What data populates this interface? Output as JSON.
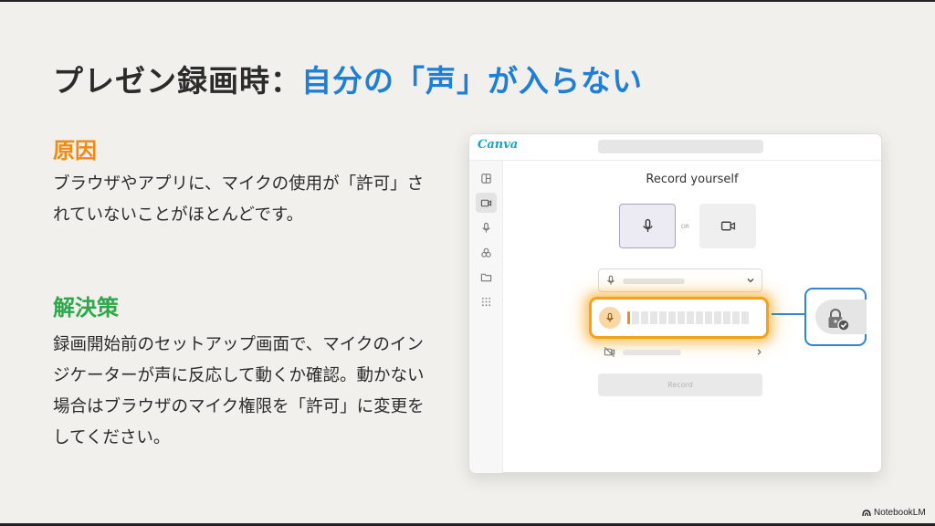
{
  "slide": {
    "title_main": "プレゼン録画時：",
    "title_accent": "自分の「声」が入らない",
    "cause_heading": "原因",
    "cause_body": "ブラウザやアプリに、マイクの使用が「許可」されていないことがほとんどです。",
    "solution_heading": "解決策",
    "solution_body": "録画開始前のセットアップ画面で、マイクのインジケーターが声に反応して動くか確認。動かない場合はブラウザのマイク権限を「許可」に変更をしてください。"
  },
  "mock": {
    "logo": "Canva",
    "panel_title": "Record yourself",
    "or_label": "OR",
    "record_label": "Record",
    "sidebar_icons": [
      "layout-icon",
      "video-icon",
      "mic-icon",
      "shapes-icon",
      "folder-icon",
      "apps-grid-icon"
    ],
    "mic_level_segments_lit": 1,
    "mic_level_segments_total": 14,
    "colors": {
      "highlight": "#f4a21a",
      "callout_border": "#2f85d0",
      "accent_blue": "#1f7fd6",
      "cause_orange": "#ef8a12",
      "solution_green": "#2da84a"
    }
  },
  "watermark": "NotebookLM"
}
